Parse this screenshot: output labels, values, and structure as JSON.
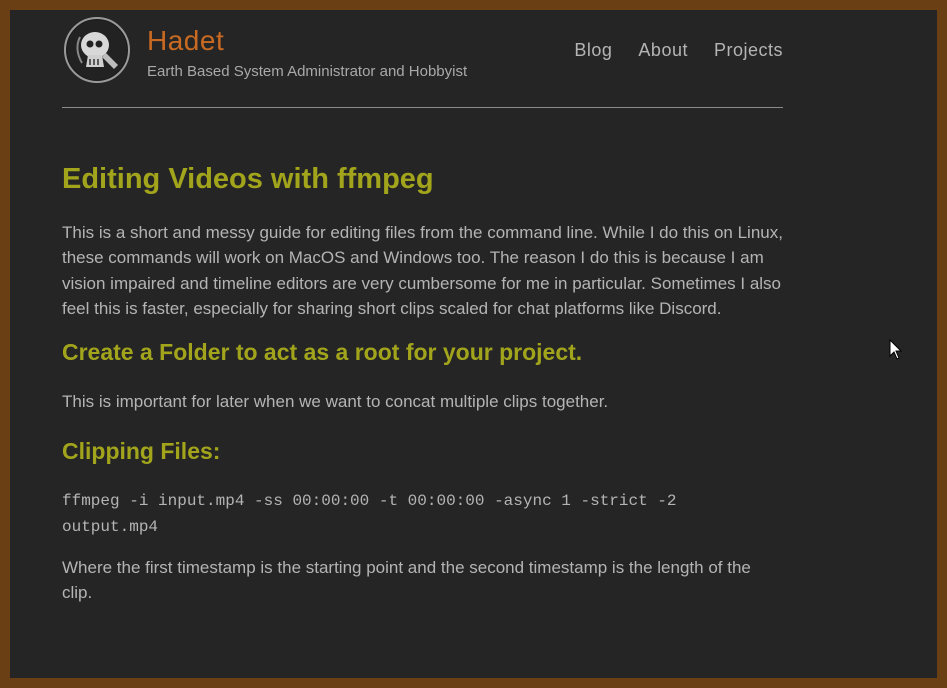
{
  "site": {
    "title": "Hadet",
    "subtitle": "Earth Based System Administrator and Hobbyist"
  },
  "nav": [
    {
      "label": "Blog"
    },
    {
      "label": "About"
    },
    {
      "label": "Projects"
    }
  ],
  "post": {
    "title": "Editing Videos with ffmpeg",
    "intro": "This is a short and messy guide for editing files from the command line. While I do this on Linux, these commands will work on MacOS and Windows too. The reason I do this is because I am vision impaired and timeline editors are very cumbersome for me in particular. Sometimes I also feel this is faster, especially for sharing short clips scaled for chat platforms like Discord.",
    "section1": {
      "heading": "Create a Folder to act as a root for your project.",
      "text": "This is important for later when we want to concat multiple clips together."
    },
    "section2": {
      "heading": "Clipping Files:",
      "code": "ffmpeg -i input.mp4 -ss 00:00:00 -t 00:00:00 -async 1 -strict -2 output.mp4",
      "text": "Where the first timestamp is the starting point and the second timestamp is the length of the clip."
    }
  },
  "colors": {
    "frame": "#6b3f14",
    "background": "#252525",
    "heading": "#a2a51c",
    "site_title": "#c96a22",
    "text": "#b4b4b4"
  },
  "icons": {
    "avatar": "skull-avatar-icon",
    "cursor": "mouse-cursor-icon"
  }
}
